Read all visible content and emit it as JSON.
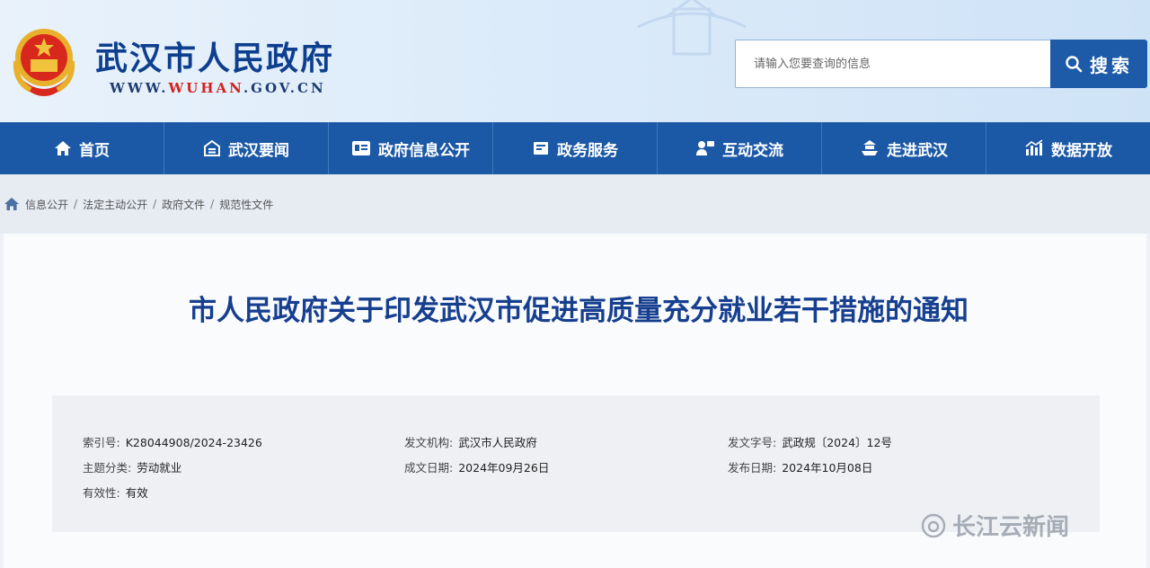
{
  "header": {
    "site_title": "武汉市人民政府",
    "site_url_prefix": "WWW.",
    "site_url_highlight": "WUHAN",
    "site_url_suffix": ".GOV.CN"
  },
  "search": {
    "placeholder": "请输入您要查询的信息",
    "button_label": "搜索"
  },
  "nav": {
    "items": [
      {
        "label": "首页",
        "icon": "home-icon"
      },
      {
        "label": "武汉要闻",
        "icon": "news-icon"
      },
      {
        "label": "政府信息公开",
        "icon": "info-card-icon"
      },
      {
        "label": "政务服务",
        "icon": "service-icon"
      },
      {
        "label": "互动交流",
        "icon": "chat-icon"
      },
      {
        "label": "走进武汉",
        "icon": "tower-icon"
      },
      {
        "label": "数据开放",
        "icon": "chart-icon"
      }
    ]
  },
  "breadcrumb": [
    "信息公开",
    "法定主动公开",
    "政府文件",
    "规范性文件"
  ],
  "document": {
    "title": "市人民政府关于印发武汉市促进高质量充分就业若干措施的通知",
    "meta": {
      "index_label": "索引号:",
      "index_value": "K28044908/2024-23426",
      "issuer_label": "发文机构:",
      "issuer_value": "武汉市人民政府",
      "doc_no_label": "发文字号:",
      "doc_no_value": "武政规〔2024〕12号",
      "topic_label": "主题分类:",
      "topic_value": "劳动就业",
      "created_label": "成文日期:",
      "created_value": "2024年09月26日",
      "published_label": "发布日期:",
      "published_value": "2024年10月08日",
      "validity_label": "有效性:",
      "validity_value": "有效"
    }
  },
  "watermark": {
    "text": "长江云新闻"
  },
  "colors": {
    "primary": "#1b58a5",
    "title_blue": "#163f8f",
    "url_red": "#d2211d"
  }
}
